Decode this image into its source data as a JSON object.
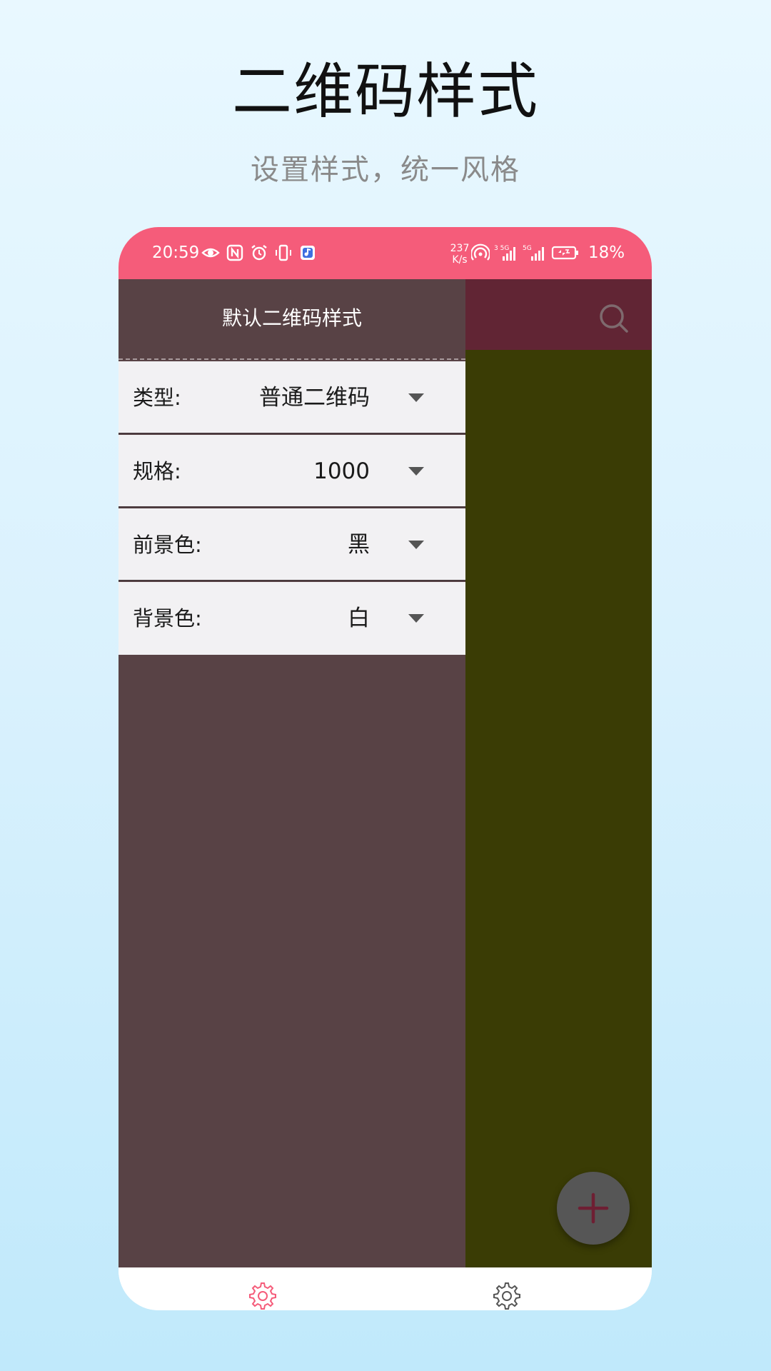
{
  "promo": {
    "title": "二维码样式",
    "subtitle": "设置样式，统一风格"
  },
  "status_bar": {
    "time": "20:59",
    "net_speed_value": "237",
    "net_speed_unit": "K/s",
    "battery": "18%",
    "color": "#f55c7a"
  },
  "drawer": {
    "title": "默认二维码样式",
    "options": [
      {
        "label": "类型:",
        "value": "普通二维码"
      },
      {
        "label": "规格:",
        "value": "1000"
      },
      {
        "label": "前景色:",
        "value": "黑"
      },
      {
        "label": "背景色:",
        "value": "白"
      }
    ]
  },
  "icons": {
    "search": "search-icon",
    "fab": "plus-icon",
    "nav_left": "gear-icon",
    "nav_right": "gear-icon"
  },
  "colors": {
    "app_bar": "#612534",
    "content": "#3a3c05",
    "drawer": "#584245",
    "accent": "#f55c7a"
  }
}
